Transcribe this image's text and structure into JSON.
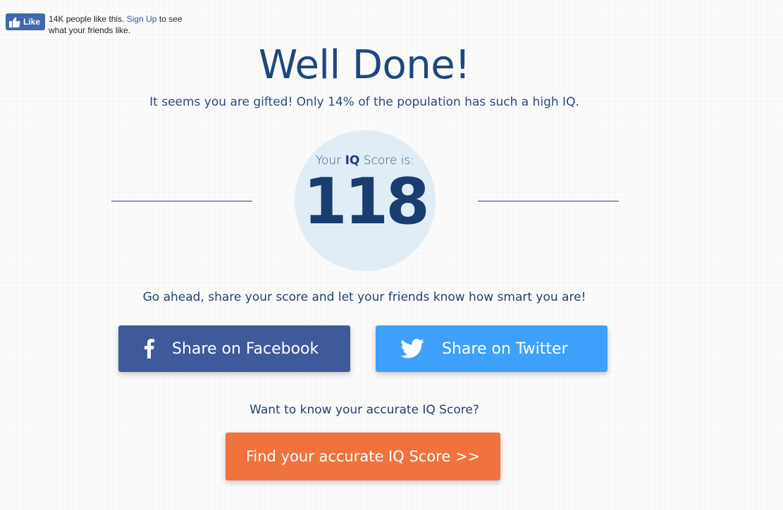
{
  "fb_widget": {
    "button_label": "Like",
    "count_text": "14K people like this.",
    "signup_link": "Sign Up",
    "suffix_text": "to see what your friends like.",
    "color": "#4267b2"
  },
  "result": {
    "title": "Well Done!",
    "subtitle": "It seems you are gifted! Only 14% of the population has such a high IQ."
  },
  "score": {
    "label_prefix": "Your",
    "label_bold": "IQ",
    "label_suffix": "Score is:",
    "value": "118"
  },
  "share": {
    "prompt": "Go ahead, share your score and let your friends know how smart you are!",
    "facebook_label": "Share on Facebook",
    "facebook_icon": "facebook-icon",
    "facebook_color": "#3f5a9a",
    "twitter_label": "Share on Twitter",
    "twitter_icon": "twitter-icon",
    "twitter_color": "#3fa0fb"
  },
  "accurate": {
    "prompt": "Want to know your accurate IQ Score?",
    "button_label": "Find your accurate IQ Score >>",
    "button_color": "#f0733e"
  }
}
